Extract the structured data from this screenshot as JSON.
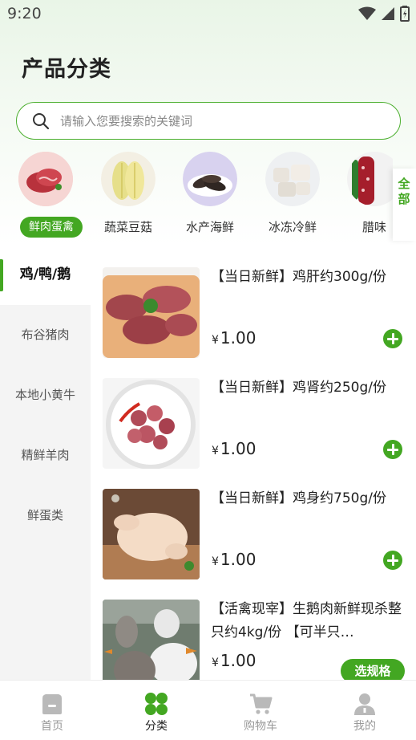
{
  "status": {
    "time": "9:20"
  },
  "page_title": "产品分类",
  "search": {
    "placeholder": "请输入您要搜索的关键词"
  },
  "categories": [
    {
      "label": "鲜肉蛋禽",
      "icon": "meat-icon",
      "active": true
    },
    {
      "label": "蔬菜豆菇",
      "icon": "cabbage-icon",
      "active": false
    },
    {
      "label": "水产海鲜",
      "icon": "sea-cucumber-icon",
      "active": false
    },
    {
      "label": "冰冻冷鲜",
      "icon": "frozen-food-icon",
      "active": false
    },
    {
      "label": "腊味",
      "icon": "sausage-icon",
      "active": false
    }
  ],
  "all_button": "全部",
  "sidebar": {
    "items": [
      {
        "label": "鸡/鸭/鹅"
      },
      {
        "label": "布谷猪肉"
      },
      {
        "label": "本地小黄牛"
      },
      {
        "label": "精鲜羊肉"
      },
      {
        "label": "鲜蛋类"
      }
    ]
  },
  "products": [
    {
      "name": "【当日新鲜】鸡肝约300g/份",
      "currency": "¥",
      "price": "1.00",
      "image": "chicken-liver"
    },
    {
      "name": "【当日新鲜】鸡肾约250g/份",
      "currency": "¥",
      "price": "1.00",
      "image": "chicken-gizzard"
    },
    {
      "name": "【当日新鲜】鸡身约750g/份",
      "currency": "¥",
      "price": "1.00",
      "image": "whole-chicken"
    },
    {
      "name": "【活禽现宰】生鹅肉新鲜现杀整只约4kg/份 【可半只…",
      "currency": "¥",
      "price": "1.00",
      "image": "geese",
      "spec_label": "选规格"
    }
  ],
  "tabbar": {
    "items": [
      {
        "label": "首页",
        "icon": "home-icon"
      },
      {
        "label": "分类",
        "icon": "category-icon",
        "active": true
      },
      {
        "label": "购物车",
        "icon": "cart-icon"
      },
      {
        "label": "我的",
        "icon": "profile-icon"
      }
    ]
  },
  "colors": {
    "accent": "#43a722",
    "sidebar_bg": "#f4f4f4"
  }
}
